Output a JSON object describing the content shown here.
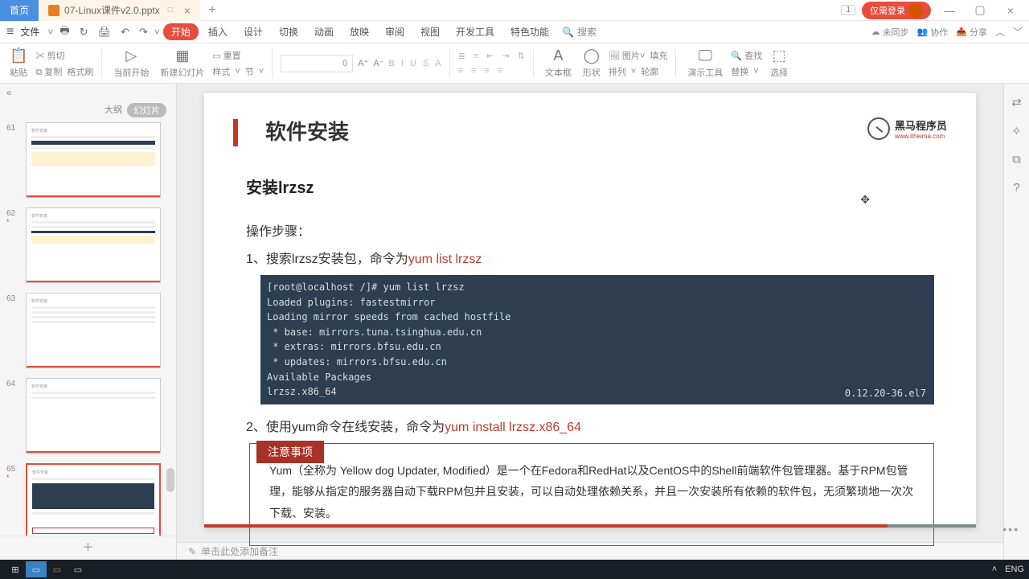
{
  "titlebar": {
    "home": "首页",
    "file": "07-Linux课件v2.0.pptx",
    "modified": "□",
    "badge": "1",
    "login": "仅需登录"
  },
  "menubar": {
    "fileword": "文件",
    "tabs": {
      "start": "开始",
      "insert": "插入",
      "design": "设计",
      "transition": "切换",
      "anim": "动画",
      "show": "放映",
      "review": "审阅",
      "view": "视图",
      "dev": "开发工具",
      "special": "特色功能"
    },
    "search_ph": "搜索",
    "right": {
      "nosync": "未同步",
      "coop": "协作",
      "share": "分享"
    }
  },
  "ribbon": {
    "paste": "粘贴",
    "cut": "剪切",
    "copy": "复制",
    "fmt": "格式刷",
    "curslide": "当前开始",
    "newslide": "新建幻灯片",
    "style": "样式",
    "section": "节",
    "fontsize": "0",
    "reset": "重置",
    "textbox": "文本框",
    "shape": "形状",
    "arrange": "排列",
    "pic": "图片",
    "fill": "填充",
    "outline": "轮廓",
    "demotools": "演示工具",
    "replace": "替换",
    "find": "查找",
    "select": "选择"
  },
  "sidebar": {
    "outline": "大纲",
    "slides": "幻灯片",
    "nums": [
      "61",
      "62",
      "63",
      "64",
      "65"
    ]
  },
  "slide": {
    "title": "软件安装",
    "logo_main": "黑马程序员",
    "logo_sub": "www.itheima.com",
    "subtitle": "安装lrzsz",
    "steps_label": "操作步骤：",
    "step1_a": "1、搜索lrzsz安装包，命令为",
    "step1_cmd": "yum list lrzsz",
    "terminal": "[root@localhost /]# yum list lrzsz\nLoaded plugins: fastestmirror\nLoading mirror speeds from cached hostfile\n * base: mirrors.tuna.tsinghua.edu.cn\n * extras: mirrors.bfsu.edu.cn\n * updates: mirrors.bfsu.edu.cn\nAvailable Packages\nlrzsz.x86_64",
    "terminal_ver": "0.12.20-36.el7",
    "step2_a": "2、使用yum命令在线安装，命令为",
    "step2_cmd": "yum install lrzsz.x86_64",
    "note_label": "注意事项",
    "note_body": "Yum（全称为 Yellow dog Updater, Modified）是一个在Fedora和RedHat以及CentOS中的Shell前端软件包管理器。基于RPM包管理，能够从指定的服务器自动下载RPM包并且安装，可以自动处理依赖关系，并且一次安装所有依赖的软件包，无须繁琐地一次次下载、安装。"
  },
  "notes": {
    "placeholder": "单击此处添加备注"
  },
  "taskbar": {
    "lang": "ENG"
  }
}
